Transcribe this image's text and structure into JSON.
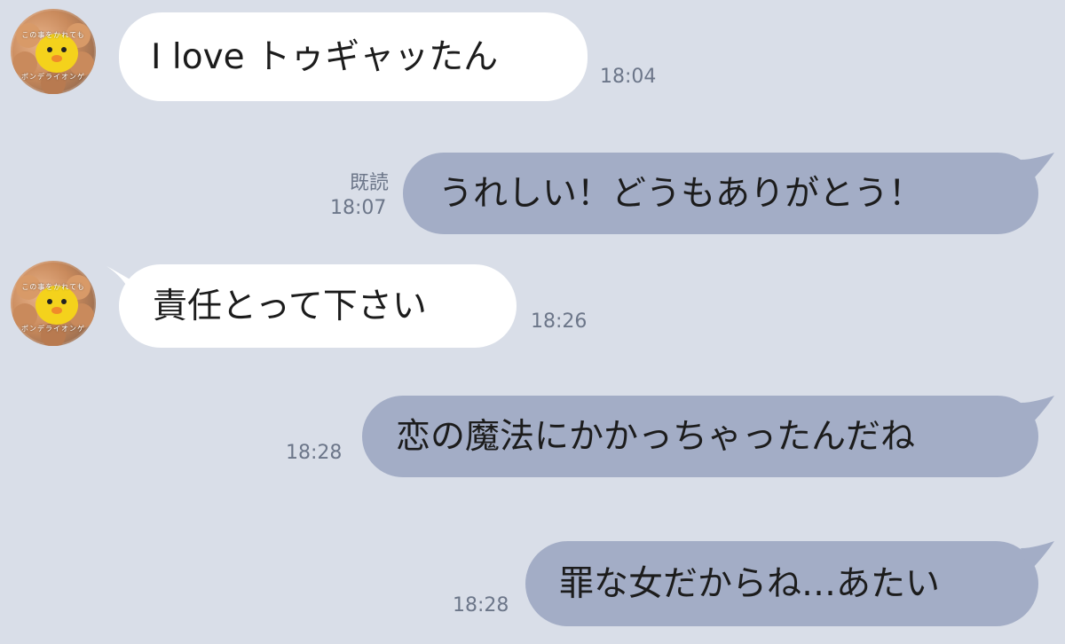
{
  "messages": [
    {
      "direction": "incoming",
      "text": "I love トゥギャッたん",
      "time": "18:04"
    },
    {
      "direction": "outgoing",
      "text": "うれしい！どうもありがとう！",
      "read_label": "既読",
      "time": "18:07"
    },
    {
      "direction": "incoming",
      "text": "責任とって下さい",
      "time": "18:26"
    },
    {
      "direction": "outgoing",
      "text": "恋の魔法にかかっちゃったんだね",
      "time": "18:28"
    },
    {
      "direction": "outgoing",
      "text": "罪な女だからね…あたい",
      "time": "18:28"
    }
  ],
  "avatar": {
    "caption_top": "この事をかれても",
    "caption_bottom": "ポンデライオンゲ"
  },
  "colors": {
    "background": "#d9dee8",
    "incoming_bubble": "#ffffff",
    "outgoing_bubble": "#a3adc6",
    "timestamp": "#6c7689"
  }
}
